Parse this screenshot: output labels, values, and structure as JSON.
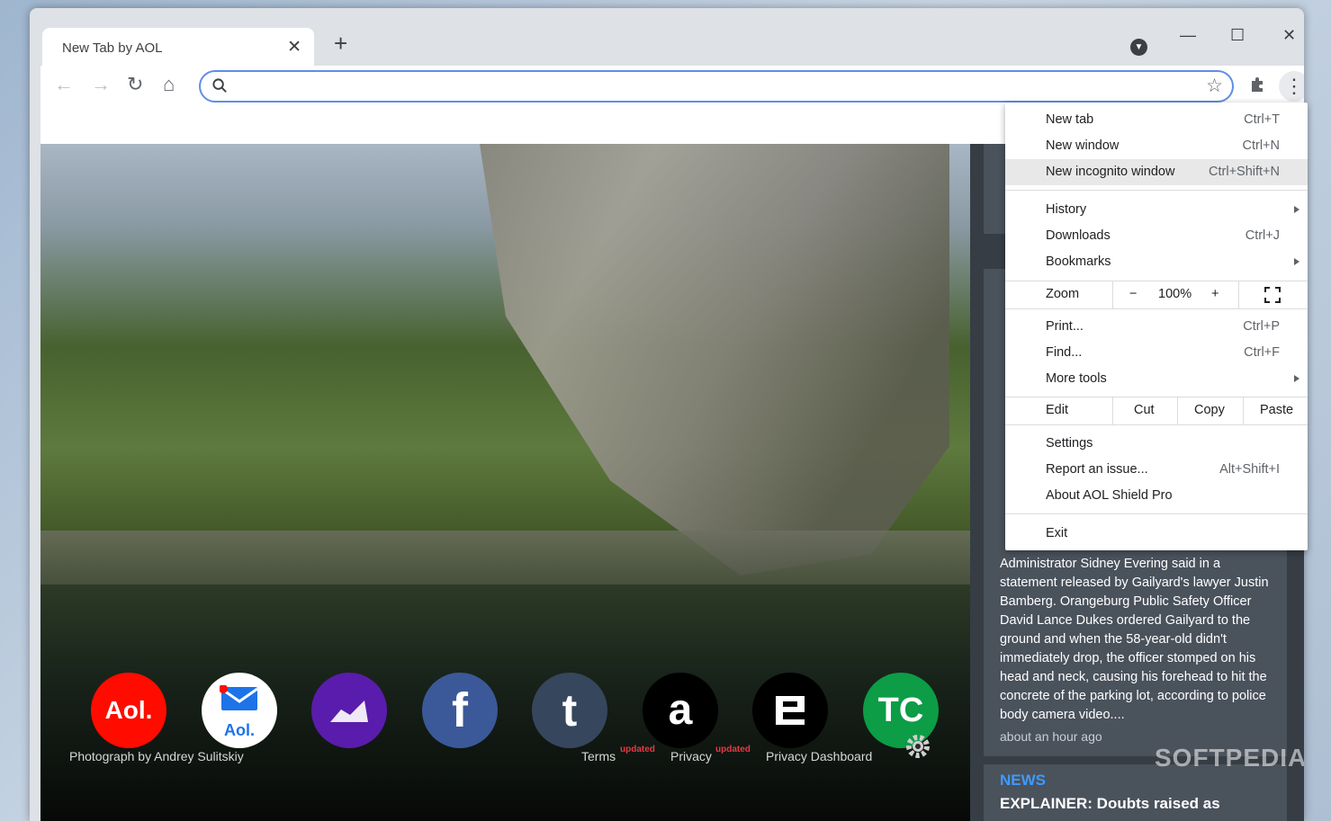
{
  "browser": {
    "tab_title": "New Tab by AOL",
    "tab_close": "✕",
    "new_tab": "+",
    "omnibox_value": "",
    "profile_glyph": "▼",
    "star_glyph": "☆",
    "menu_glyph": "⋮",
    "window_controls": {
      "minimize": "—",
      "maximize": "☐",
      "close": "✕"
    },
    "nav": {
      "back": "←",
      "forward": "→",
      "reload": "↻",
      "home": "⌂"
    }
  },
  "shortcuts": [
    {
      "label": "Aol.",
      "bg": "#ff0b00"
    },
    {
      "label": "Aol.",
      "bg": "#ffffff"
    },
    {
      "label": "",
      "bg": "#5a1cac"
    },
    {
      "label": "f",
      "bg": "#3b5998"
    },
    {
      "label": "t",
      "bg": "#36465d"
    },
    {
      "label": "a",
      "bg": "#000000"
    },
    {
      "label": "",
      "bg": "#000000"
    },
    {
      "label": "TC",
      "bg": "#0c9d46"
    }
  ],
  "footer": {
    "photo_credit": "Photograph by Andrey Sulitskiy",
    "terms": "Terms",
    "terms_badge": "updated",
    "privacy": "Privacy",
    "privacy_badge": "updated",
    "privacy_dashboard": "Privacy Dashboard"
  },
  "news": {
    "story_text": "Administrator Sidney Evering said in a statement released by Gailyard's lawyer Justin Bamberg. Orangeburg Public Safety Officer David Lance Dukes ordered Gailyard to the ground and when the 58-year-old didn't immediately drop, the officer stomped on his head and neck, causing his forehead to hit the concrete of the parking lot, according to police body camera video....",
    "story_time": "about an hour ago",
    "next_label": "NEWS",
    "next_headline": "EXPLAINER: Doubts raised as"
  },
  "watermark": "SOFTPEDIA",
  "menu": {
    "new_tab": {
      "label": "New tab",
      "shortcut": "Ctrl+T"
    },
    "new_window": {
      "label": "New window",
      "shortcut": "Ctrl+N"
    },
    "new_incognito": {
      "label": "New incognito window",
      "shortcut": "Ctrl+Shift+N"
    },
    "history": {
      "label": "History"
    },
    "downloads": {
      "label": "Downloads",
      "shortcut": "Ctrl+J"
    },
    "bookmarks": {
      "label": "Bookmarks"
    },
    "zoom": {
      "label": "Zoom",
      "minus": "−",
      "value": "100%",
      "plus": "+"
    },
    "print": {
      "label": "Print...",
      "shortcut": "Ctrl+P"
    },
    "find": {
      "label": "Find...",
      "shortcut": "Ctrl+F"
    },
    "more_tools": {
      "label": "More tools"
    },
    "edit": {
      "label": "Edit",
      "cut": "Cut",
      "copy": "Copy",
      "paste": "Paste"
    },
    "settings": {
      "label": "Settings"
    },
    "report_issue": {
      "label": "Report an issue...",
      "shortcut": "Alt+Shift+I"
    },
    "about": {
      "label": "About AOL Shield Pro"
    },
    "exit": {
      "label": "Exit"
    }
  }
}
